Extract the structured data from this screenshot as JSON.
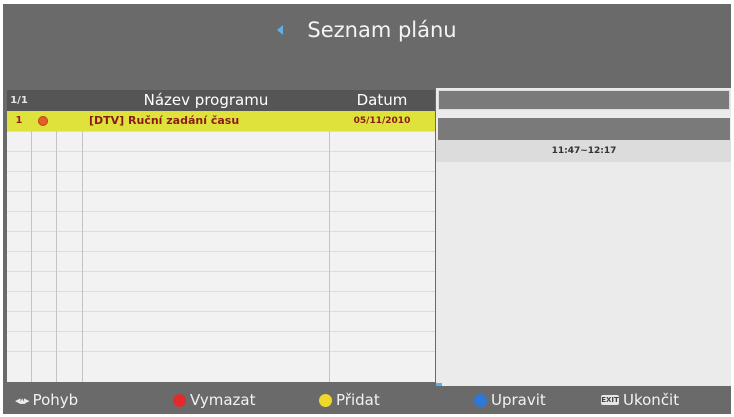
{
  "header": {
    "title": "Seznam plánu"
  },
  "table": {
    "page_indicator": "1/1",
    "columns": {
      "name": "Název programu",
      "date": "Datum"
    },
    "rows": [
      {
        "number": "1",
        "name": "[DTV] Ruční zadání času",
        "date": "05/11/2010"
      }
    ]
  },
  "detail": {
    "time_range": "11:47~12:17"
  },
  "footer": {
    "move": "Pohyb",
    "delete": "Vymazat",
    "add": "Přidat",
    "edit": "Upravit",
    "exit": "Ukončit",
    "exit_key": "EXIT"
  },
  "colors": {
    "selected_row": "#dfe23b",
    "red_key": "#e22a2a",
    "yellow_key": "#f0d82a",
    "blue_key": "#2f78d8"
  },
  "icons": [
    "left-arrow-icon",
    "right-arrow-icon",
    "record-icon",
    "navigation-icon",
    "red-button-icon",
    "yellow-button-icon",
    "blue-button-icon",
    "exit-key-icon"
  ]
}
